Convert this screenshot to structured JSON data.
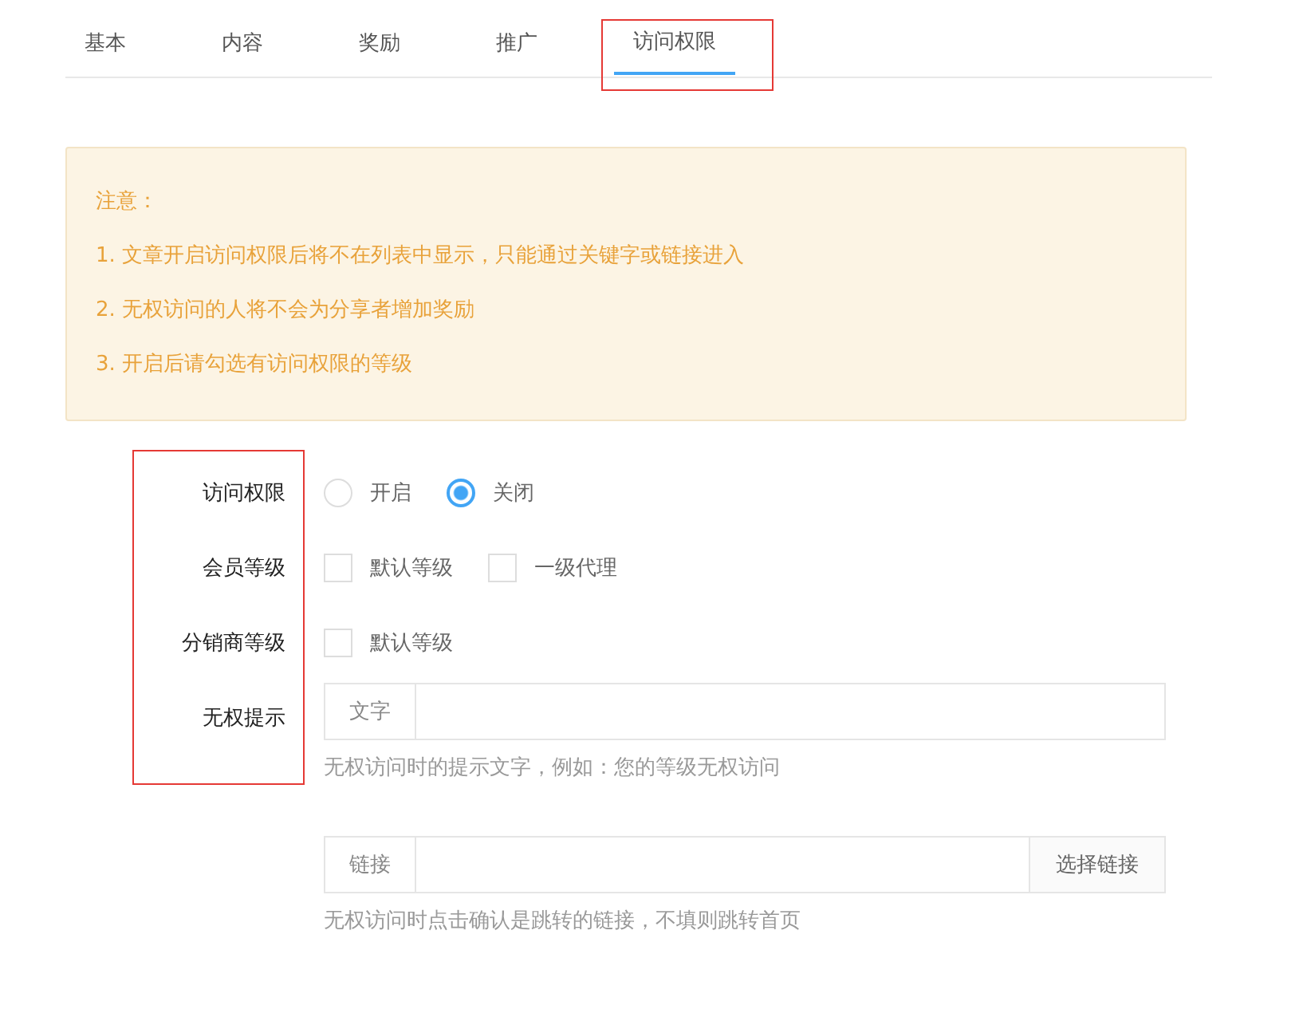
{
  "tabs": [
    {
      "label": "基本",
      "selected": false,
      "highlighted": false
    },
    {
      "label": "内容",
      "selected": false,
      "highlighted": false
    },
    {
      "label": "奖励",
      "selected": false,
      "highlighted": false
    },
    {
      "label": "推广",
      "selected": false,
      "highlighted": false
    },
    {
      "label": "访问权限",
      "selected": true,
      "highlighted": true
    }
  ],
  "notice": {
    "title": "注意：",
    "items": [
      "1. 文章开启访问权限后将不在列表中显示，只能通过关键字或链接进入",
      "2. 无权访问的人将不会为分享者增加奖励",
      "3. 开启后请勾选有访问权限的等级"
    ]
  },
  "form": {
    "labels_highlighted": true,
    "fields": [
      {
        "kind": "radio",
        "label": "访问权限",
        "options": [
          {
            "label": "开启",
            "selected": false
          },
          {
            "label": "关闭",
            "selected": true
          }
        ]
      },
      {
        "kind": "checkbox",
        "label": "会员等级",
        "options": [
          {
            "label": "默认等级",
            "checked": false
          },
          {
            "label": "一级代理",
            "checked": false
          }
        ]
      },
      {
        "kind": "checkbox",
        "label": "分销商等级",
        "options": [
          {
            "label": "默认等级",
            "checked": false
          }
        ]
      },
      {
        "kind": "text_input",
        "label": "无权提示",
        "prefix": "文字",
        "help": "无权访问时的提示文字，例如：您的等级无权访问"
      },
      {
        "kind": "link_input",
        "prefix": "链接",
        "button": "选择链接",
        "help": "无权访问时点击确认是跳转的链接，不填则跳转首页"
      }
    ]
  }
}
